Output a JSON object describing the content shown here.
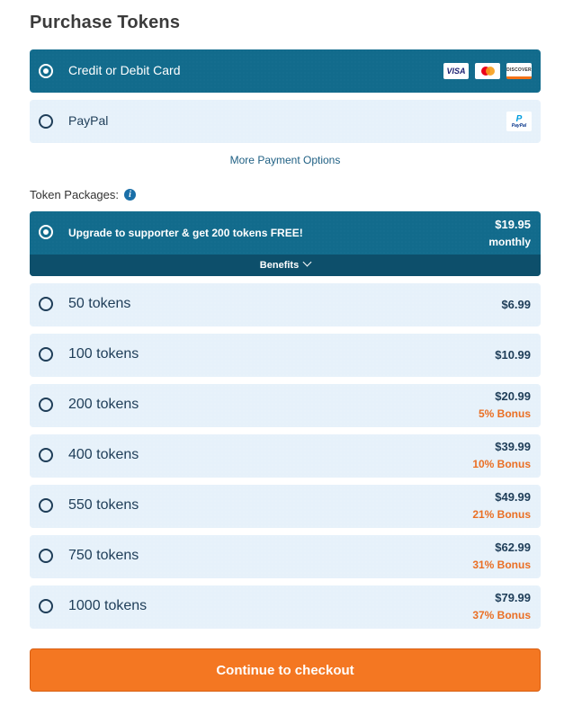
{
  "title": "Purchase Tokens",
  "payment_methods": [
    {
      "label": "Credit or Debit Card",
      "selected": true,
      "icons": [
        "visa-icon",
        "mastercard-icon",
        "discover-icon"
      ],
      "visa_text": "VISA",
      "discover_text": "DISCOVER"
    },
    {
      "label": "PayPal",
      "selected": false,
      "icons": [
        "paypal-icon"
      ],
      "icon_text": "PayPal"
    }
  ],
  "more_payment_options": "More Payment Options",
  "token_packages_label": "Token Packages:",
  "info_icon": "i",
  "supporter": {
    "label": "Upgrade to supporter & get 200 tokens FREE!",
    "price": "$19.95",
    "period": "monthly",
    "selected": true,
    "benefits_label": "Benefits"
  },
  "packages": [
    {
      "label": "50 tokens",
      "price": "$6.99",
      "bonus": ""
    },
    {
      "label": "100 tokens",
      "price": "$10.99",
      "bonus": ""
    },
    {
      "label": "200 tokens",
      "price": "$20.99",
      "bonus": "5% Bonus"
    },
    {
      "label": "400 tokens",
      "price": "$39.99",
      "bonus": "10% Bonus"
    },
    {
      "label": "550 tokens",
      "price": "$49.99",
      "bonus": "21% Bonus"
    },
    {
      "label": "750 tokens",
      "price": "$62.99",
      "bonus": "31% Bonus"
    },
    {
      "label": "1000 tokens",
      "price": "$79.99",
      "bonus": "37% Bonus"
    }
  ],
  "cta_label": "Continue to checkout",
  "colors": {
    "primary": "#126b8c",
    "primary_dark": "#0d4f6b",
    "row_bg": "#e6f1fa",
    "accent": "#f47722",
    "bonus": "#ea6f24",
    "text_dark": "#1e3d58"
  }
}
